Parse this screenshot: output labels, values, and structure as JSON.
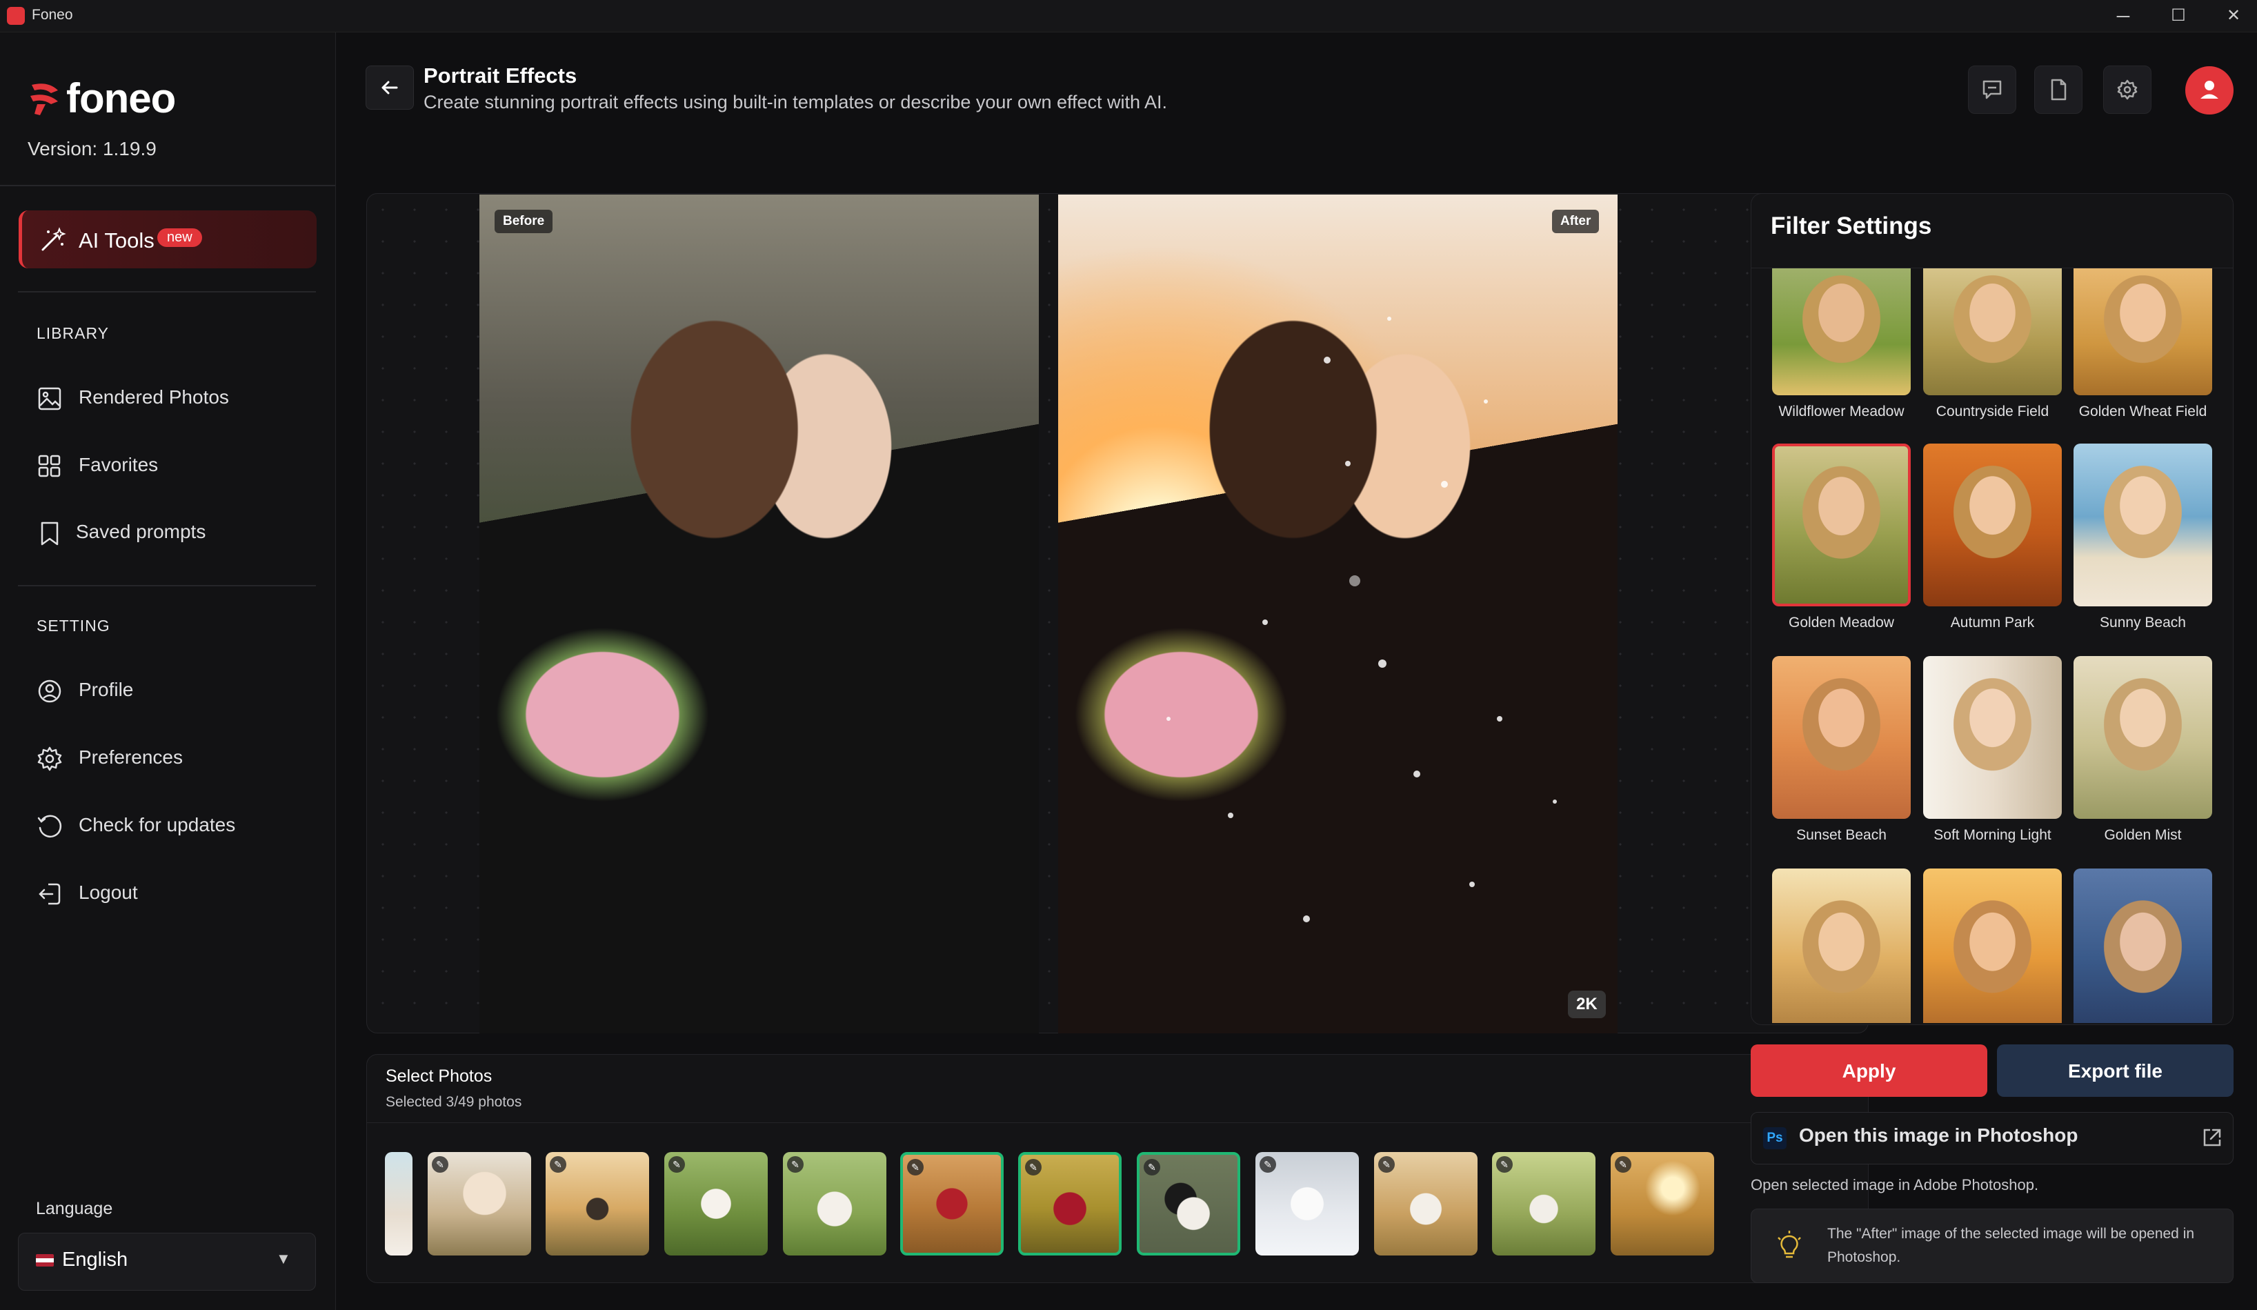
{
  "window": {
    "title": "Foneo",
    "minimize": "─",
    "maximize": "☐",
    "close": "✕"
  },
  "brand": {
    "name": "foneo",
    "version": "Version: 1.19.9"
  },
  "sidebar": {
    "ai_tools": {
      "label": "AI Tools",
      "badge": "new"
    },
    "library_title": "LIBRARY",
    "library": [
      {
        "label": "Rendered Photos",
        "icon": "image-icon"
      },
      {
        "label": "Favorites",
        "icon": "grid-icon"
      },
      {
        "label": "Saved prompts",
        "icon": "bookmark-icon"
      }
    ],
    "setting_title": "SETTING",
    "setting": [
      {
        "label": "Profile",
        "icon": "user-circle-icon"
      },
      {
        "label": "Preferences",
        "icon": "gear-icon"
      },
      {
        "label": "Check for updates",
        "icon": "refresh-icon"
      },
      {
        "label": "Logout",
        "icon": "logout-icon"
      }
    ],
    "language_label": "Language",
    "language_value": "English"
  },
  "header": {
    "title": "Portrait Effects",
    "subtitle": "Create stunning portrait effects using built-in templates or describe your own effect with AI."
  },
  "preview": {
    "before_label": "Before",
    "after_label": "After",
    "resolution": "2K"
  },
  "photos": {
    "title": "Select Photos",
    "count": "Selected 3/49 photos",
    "selected_indices": [
      5,
      6,
      7
    ]
  },
  "filters": {
    "title": "Filter Settings",
    "items": [
      {
        "name": "Wildflower Meadow",
        "selected": false
      },
      {
        "name": "Countryside Field",
        "selected": false
      },
      {
        "name": "Golden Wheat Field",
        "selected": false
      },
      {
        "name": "Golden Meadow",
        "selected": true
      },
      {
        "name": "Autumn Park",
        "selected": false
      },
      {
        "name": "Sunny Beach",
        "selected": false
      },
      {
        "name": "Sunset Beach",
        "selected": false
      },
      {
        "name": "Soft Morning Light",
        "selected": false
      },
      {
        "name": "Golden Mist",
        "selected": false
      },
      {
        "name": "",
        "selected": false
      },
      {
        "name": "",
        "selected": false
      },
      {
        "name": "",
        "selected": false
      }
    ]
  },
  "actions": {
    "apply": "Apply",
    "export": "Export file",
    "photoshop_icon": "Ps",
    "photoshop_label": "Open this image in Photoshop",
    "photoshop_desc": "Open selected image in Adobe Photoshop.",
    "info": "The \"After\" image of the selected image will be opened in Photoshop."
  },
  "colors": {
    "accent": "#e2353a",
    "selected_thumb": "#1fb873",
    "export_bg": "#23324a"
  }
}
